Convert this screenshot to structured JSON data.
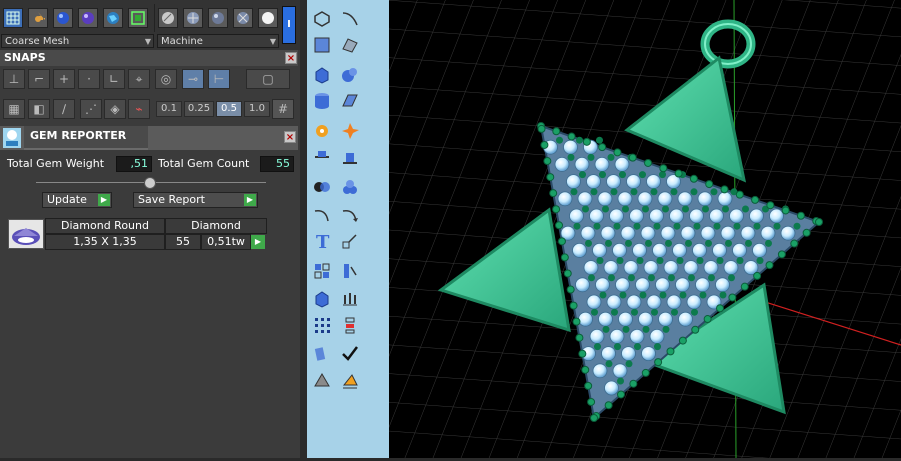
{
  "toolbar": {
    "mesh_mode": "Coarse Mesh",
    "material_mode": "Machine",
    "info_label": "I"
  },
  "snaps": {
    "title": "SNAPS",
    "tolerances": [
      "0.1",
      "0.25",
      "0.5",
      "1.0"
    ],
    "active_tolerance": "0.5"
  },
  "gem_reporter": {
    "title": "GEM REPORTER",
    "total_weight_label": "Total Gem Weight",
    "total_weight_value": ",51",
    "total_count_label": "Total Gem Count",
    "total_count_value": "55",
    "update_label": "Update",
    "save_report_label": "Save Report",
    "table": {
      "header_cut": "Diamond Round",
      "header_material": "Diamond",
      "size": "1,35 X 1,35",
      "count": "55",
      "weight": "0,51tw"
    }
  },
  "colors": {
    "panel_bg": "#3b3b3b",
    "toolbar_bg": "#a7d2e8",
    "viewport_bg": "#000000",
    "grid_line": "#3a3a3a",
    "model_green": "#3fc79a",
    "gem_light_blue": "#c9ecff",
    "prong_green": "#0c7a4d",
    "axis_red": "#d02020",
    "axis_green": "#2aa02a",
    "accent_play": "#3fa94a"
  },
  "icons": {
    "top_toolbar": [
      "wireframe-grid-icon",
      "move-gizmo-icon",
      "blue-sphere-icon",
      "purple-sphere-icon",
      "globe-icon",
      "rectangle-view-icon",
      "gray-sphere-icon",
      "sphere-wire-icon",
      "dark-sphere-icon",
      "sphere-slash-icon",
      "white-sphere-icon"
    ],
    "side_toolbar": [
      "polygon-icon",
      "curve-icon",
      "box-select-icon",
      "surface-icon",
      "cube-icon",
      "spheres-icon",
      "cylinder-icon",
      "plane-icon",
      "gear-icon",
      "explode-icon",
      "align-icon",
      "align-bottom-icon",
      "boolean-icon",
      "gem-set-icon",
      "arc-icon",
      "arc-arrow-icon",
      "text-icon",
      "scale-icon",
      "array-icon",
      "rail-icon",
      "box-icon",
      "prongs-icon",
      "grid-dots-icon",
      "layer-icon",
      "bend-icon",
      "check-icon",
      "cone-icon",
      "tilt-icon"
    ]
  }
}
